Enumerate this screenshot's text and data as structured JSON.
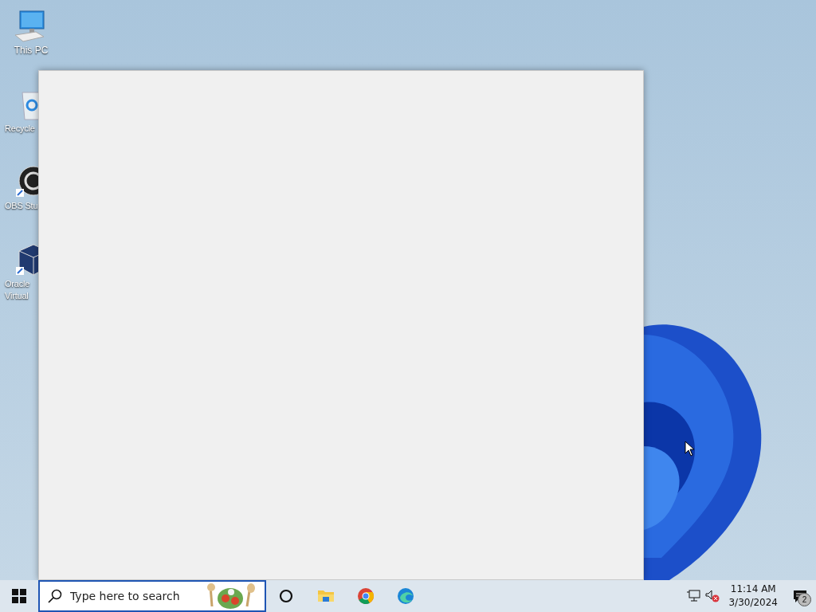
{
  "desktop": {
    "icons": [
      {
        "kind": "computer",
        "lines": [
          "This PC"
        ]
      },
      {
        "kind": "bin",
        "lines": [
          "Recycle"
        ]
      },
      {
        "kind": "obs",
        "lines": [
          "OBS Stu"
        ]
      },
      {
        "kind": "box",
        "lines": [
          "Oracle",
          "Virtual"
        ]
      }
    ]
  },
  "window": {
    "kind": "blank"
  },
  "taskbar": {
    "search": {
      "placeholder": "Type here to search"
    },
    "apps": [
      {
        "kind": "cortana"
      },
      {
        "kind": "folder"
      },
      {
        "kind": "chrome"
      },
      {
        "kind": "edge"
      }
    ],
    "time": "11:14 AM",
    "date": "3/30/2024",
    "notifications": "2"
  }
}
